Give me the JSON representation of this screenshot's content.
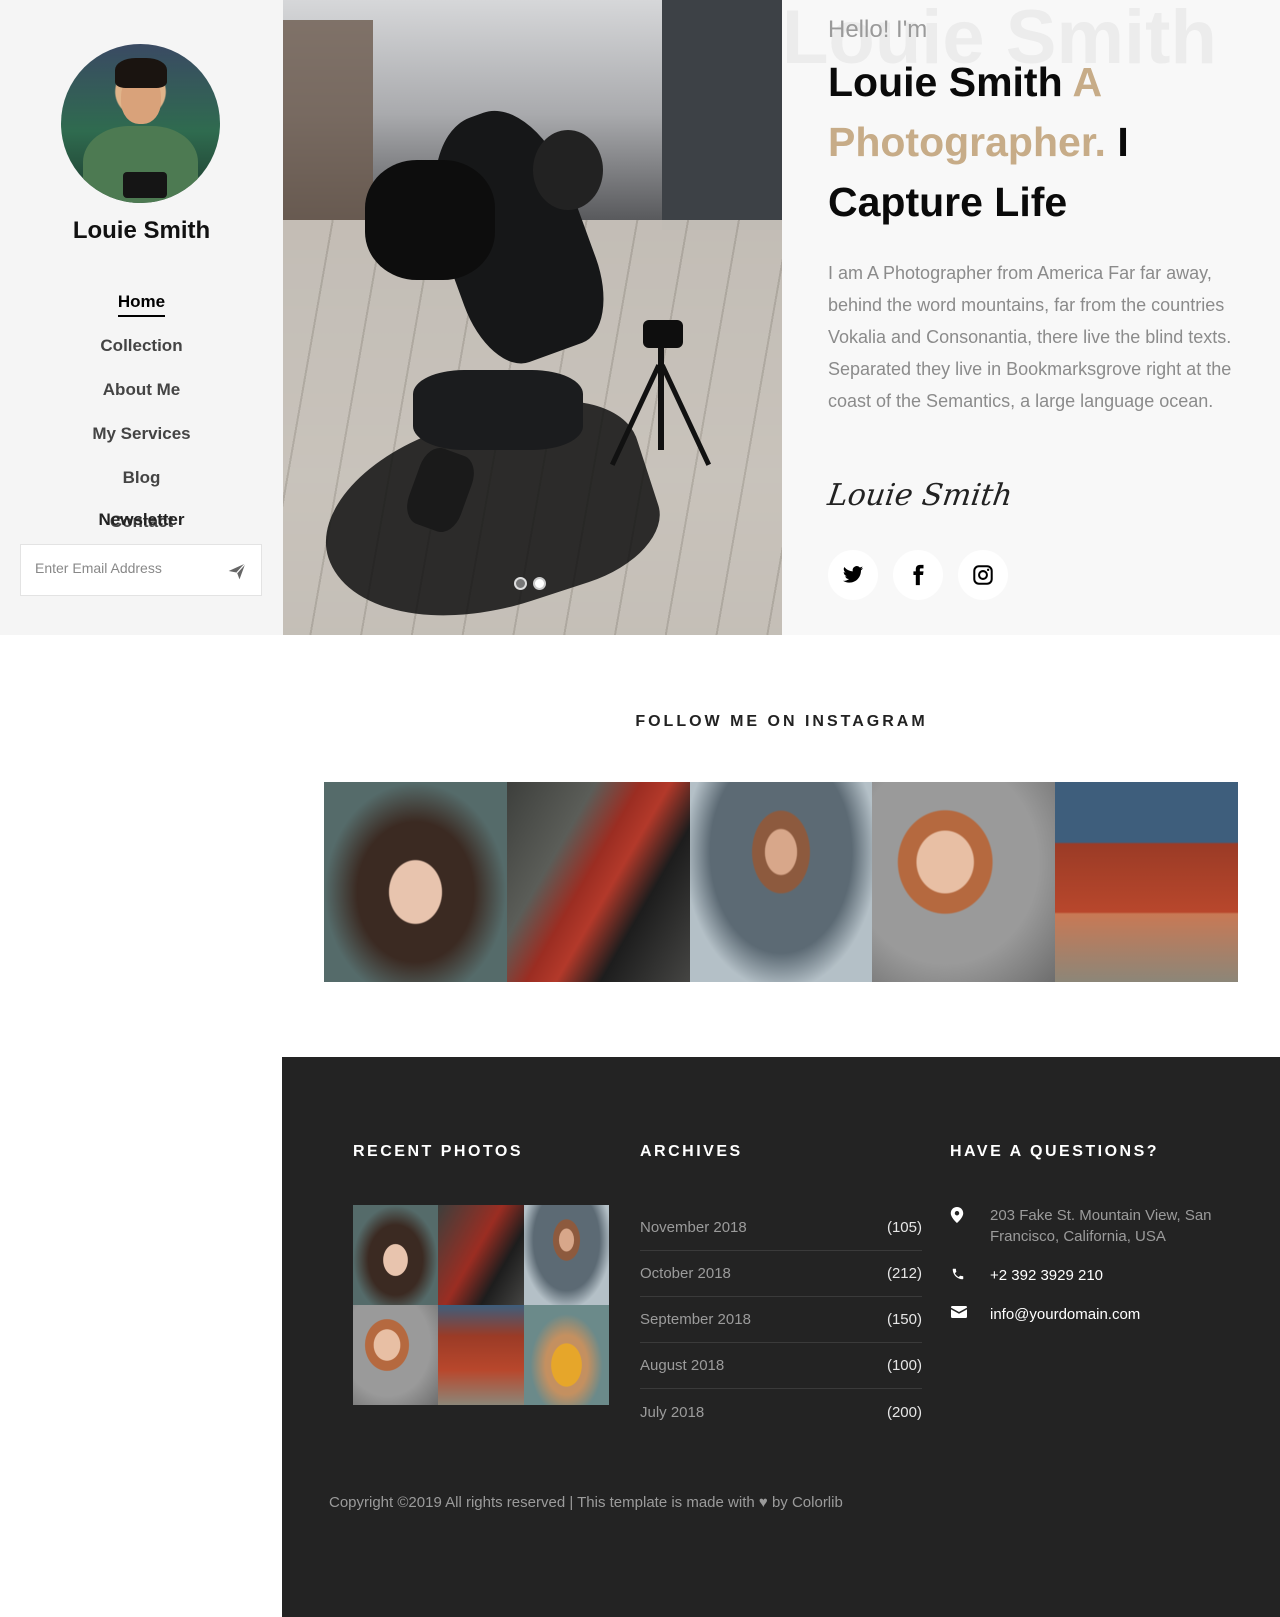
{
  "sidebar": {
    "name": "Louie Smith",
    "nav": [
      "Home",
      "Collection",
      "About Me",
      "My Services",
      "Blog",
      "Contact"
    ],
    "newsletter_title": "Newsletter",
    "email_placeholder": "Enter Email Address"
  },
  "hero": {
    "slider_dots": [
      true,
      false
    ]
  },
  "intro": {
    "bg_word": "Louie Smith",
    "hello": "Hello! I'm",
    "name": "Louie Smith",
    "role": "A Photographer.",
    "tagline": "I Capture Life",
    "description": "I am A Photographer from America Far far away, behind the word mountains, far from the countries Vokalia and Consonantia, there live the blind texts. Separated they live in Bookmarksgrove right at the coast of the Semantics, a large language ocean.",
    "signature": "Louie Smith",
    "socials": [
      "twitter-icon",
      "facebook-icon",
      "instagram-icon"
    ]
  },
  "instagram": {
    "title": "FOLLOW ME ON INSTAGRAM"
  },
  "footer": {
    "recent_title": "RECENT PHOTOS",
    "archives_title": "ARCHIVES",
    "archives": [
      {
        "month": "November 2018",
        "count": "(105)"
      },
      {
        "month": "October 2018",
        "count": "(212)"
      },
      {
        "month": "September 2018",
        "count": "(150)"
      },
      {
        "month": "August 2018",
        "count": "(100)"
      },
      {
        "month": "July 2018",
        "count": "(200)"
      }
    ],
    "contact_title": "HAVE A QUESTIONS?",
    "address": "203 Fake St. Mountain View, San Francisco, California, USA",
    "phone": "+2 392 3929 210",
    "email": "info@yourdomain.com",
    "copyright_pre": "Copyright ©2019 All rights reserved | This template is made with",
    "copyright_post": "by Colorlib"
  },
  "colors": {
    "accent": "#c7ac88",
    "footer_bg": "#232323",
    "sidebar_bg": "#f5f5f5"
  }
}
